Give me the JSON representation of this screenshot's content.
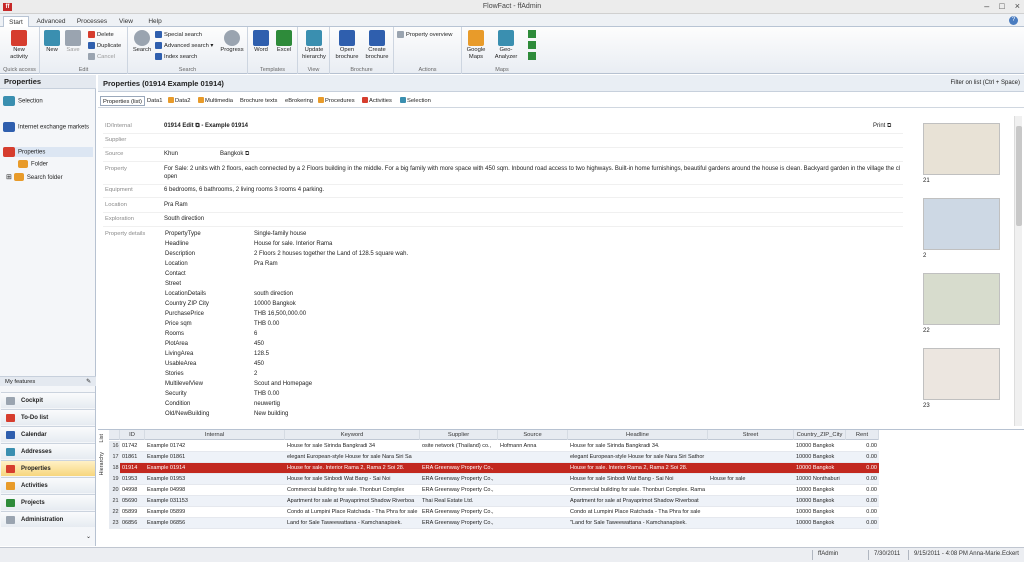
{
  "window": {
    "title": "FlowFact - ffAdmin",
    "logo": "ff"
  },
  "tabs": [
    "Start",
    "Advanced",
    "Processes",
    "View",
    "Help"
  ],
  "ribbon": {
    "quick_access": {
      "label": "Quick access",
      "new_activity": "New\nactivity"
    },
    "edit": {
      "label": "Edit",
      "new": "New",
      "save": "Save",
      "delete": "Delete",
      "duplicate": "Duplicate",
      "cancel": "Cancel"
    },
    "search": {
      "label": "Search",
      "search": "Search",
      "special": "Special search",
      "advanced": "Advanced search",
      "index": "Index search",
      "progress": "Progress"
    },
    "templates": {
      "label": "Templates",
      "word": "Word",
      "excel": "Excel"
    },
    "view": {
      "label": "View",
      "update": "Update\nhierarchy"
    },
    "brochure": {
      "label": "Brochure",
      "open": "Open\nbrochure",
      "create": "Create\nbrochure"
    },
    "actions": {
      "label": "Actions",
      "overview": "Property overview"
    },
    "maps": {
      "label": "Maps",
      "google": "Google\nMaps",
      "geo": "Geo-Analyzer"
    }
  },
  "left": {
    "title": "Properties",
    "nav": [
      "Selection",
      "Internet exchange markets",
      "Properties",
      "Folder",
      "Search folder"
    ],
    "my_features": "My features",
    "features": [
      "Cockpit",
      "To-Do list",
      "Calendar",
      "Addresses",
      "Properties",
      "Activities",
      "Projects",
      "Administration"
    ]
  },
  "main": {
    "title": "Properties (01914 Example  01914)",
    "filter": "Filter on list (Ctrl + Space)",
    "subtabs": [
      "Properties (list)",
      "Data1",
      "Data2",
      "Multimedia",
      "Brochure texts",
      "eBrokering",
      "Procedures",
      "Activities",
      "Selection"
    ],
    "print": "Print",
    "fields": {
      "id_label": "ID/Internal",
      "id_value": "01914 Edit",
      "id_suffix": " - Example 01914",
      "supplier_label": "Supplier",
      "source_label": "Source",
      "source_value": "Khun",
      "source_value2": "Bangkok",
      "property_label": "Property",
      "property_value": "For Sale: 2 units with 2 floors, each connected by a 2 Floors building in the middle. For a big family with more space with 450 sqm. Inbound road access to two highways. Built-in home furnishings, beautiful gardens around the house is clean. Backyard garden in the village the cl open",
      "equipment_label": "Equipment",
      "equipment_value": "6 bedrooms, 6 bathrooms, 2 living rooms 3 rooms 4 parking.",
      "location_label": "Location",
      "location_value": "Pra Ram",
      "exploration_label": "Exploration",
      "exploration_value": "South direction",
      "details_label": "Property details"
    },
    "details": [
      [
        "PropertyType",
        "Single-family house"
      ],
      [
        "Headline",
        "House for sale. Interior Rama"
      ],
      [
        "Description",
        "2 Floors 2 houses together the Land of 128.5 square wah."
      ],
      [
        "Location",
        "Pra Ram"
      ],
      [
        "Contact",
        ""
      ],
      [
        "Street",
        ""
      ],
      [
        "LocationDetails",
        "south direction"
      ],
      [
        "Country ZIP City",
        "10000 Bangkok"
      ],
      [
        "PurchasePrice",
        "THB 16,500,000.00"
      ],
      [
        "Price sqm",
        "THB 0.00"
      ],
      [
        "Rooms",
        "6"
      ],
      [
        "PlotArea",
        "450"
      ],
      [
        "LivingArea",
        "128.5"
      ],
      [
        "UsableArea",
        "450"
      ],
      [
        "Stories",
        "2"
      ],
      [
        "MultilevelView",
        "Scout and Homepage"
      ],
      [
        "Security",
        "THB 0.00"
      ],
      [
        "Condition",
        "neuwertig"
      ],
      [
        "Old/NewBuilding",
        "New building"
      ]
    ],
    "thumbs": [
      "21",
      "2",
      "22",
      "23"
    ]
  },
  "grid": {
    "vtabs": [
      "List",
      "Hierarchy"
    ],
    "columns": [
      "ID",
      "Internal",
      "Keyword",
      "Supplier",
      "Source",
      "Headline",
      "Street",
      "Country_ZIP_City",
      "Rent"
    ],
    "rows": [
      [
        "16",
        "01742",
        "Example  01742",
        "House for sale Sirinda Bangkradi 34",
        "osite network (Thailand) co.,",
        "Hofmann Anna",
        "House for sale Sirinda Bangkradi 34.",
        "",
        "10000 Bangkok",
        "0.00"
      ],
      [
        "17",
        "01861",
        "Example  01861",
        "elegant European-style House for sale Nara Siri Sa",
        "",
        "",
        "elegant European-style House for sale Nara Siri Sathor",
        "",
        "10000 Bangkok",
        "0.00"
      ],
      [
        "18",
        "01914",
        "Example  01914",
        "House for sale. Interior Rama 2, Rama 2 Soi 28.",
        "ERA Greenway Property Co.,",
        "",
        "House for sale. Interior Rama 2, Rama 2 Soi 28.",
        "",
        "10000 Bangkok",
        "0.00"
      ],
      [
        "19",
        "01953",
        "Example  01953",
        "House for sale Sinbodi Wat Bang - Sai Noi",
        "ERA Greenway Property Co.,",
        "",
        "House for sale Sinbodi Wat Bang - Sai Noi",
        "House for sale",
        "10000 Nonthaburi",
        "0.00"
      ],
      [
        "20",
        "04998",
        "Example  04998",
        "Commercial building for sale. Thonburi Complex",
        "ERA Greenway Property Co.,",
        "",
        "Commercial building for sale. Thonburi Complex. Rama",
        "",
        "10000 Bangkok",
        "0.00"
      ],
      [
        "21",
        "05690",
        "Example  031153",
        "Apartment for sale at Prayaprimot Shadow Riverboa",
        "Thai Real Estate Ltd.",
        "",
        "Apartment for sale at Prayaprimot Shadow Riverboat",
        "",
        "10000 Bangkok",
        "0.00"
      ],
      [
        "22",
        "05899",
        "Example  05899",
        "Condo at Lumpini Place Ratchada - Tha Phra for sale",
        "ERA Greenway Property Co.,",
        "",
        "Condo at Lumpini Place Ratchada - Tha Phra for sale",
        "",
        "10000 Bangkok",
        "0.00"
      ],
      [
        "23",
        "06856",
        "Example  06856",
        "Land for Sale Taweewattana - Kamchanapisek.",
        "ERA Greenway Property Co.,",
        "",
        "\"Land for Sale Taweewattana - Kamchanapisek.",
        "",
        "10000 Bangkok",
        "0.00"
      ]
    ]
  },
  "status": {
    "user": "ffAdmin",
    "date": "7/30/2011",
    "datetime": "9/15/2011 - 4:08 PM Anna-Marie.Eckert"
  },
  "colors": {
    "accent": "#c2281f",
    "ribbon": "#e9edf3",
    "panel": "#f4f6f9"
  }
}
